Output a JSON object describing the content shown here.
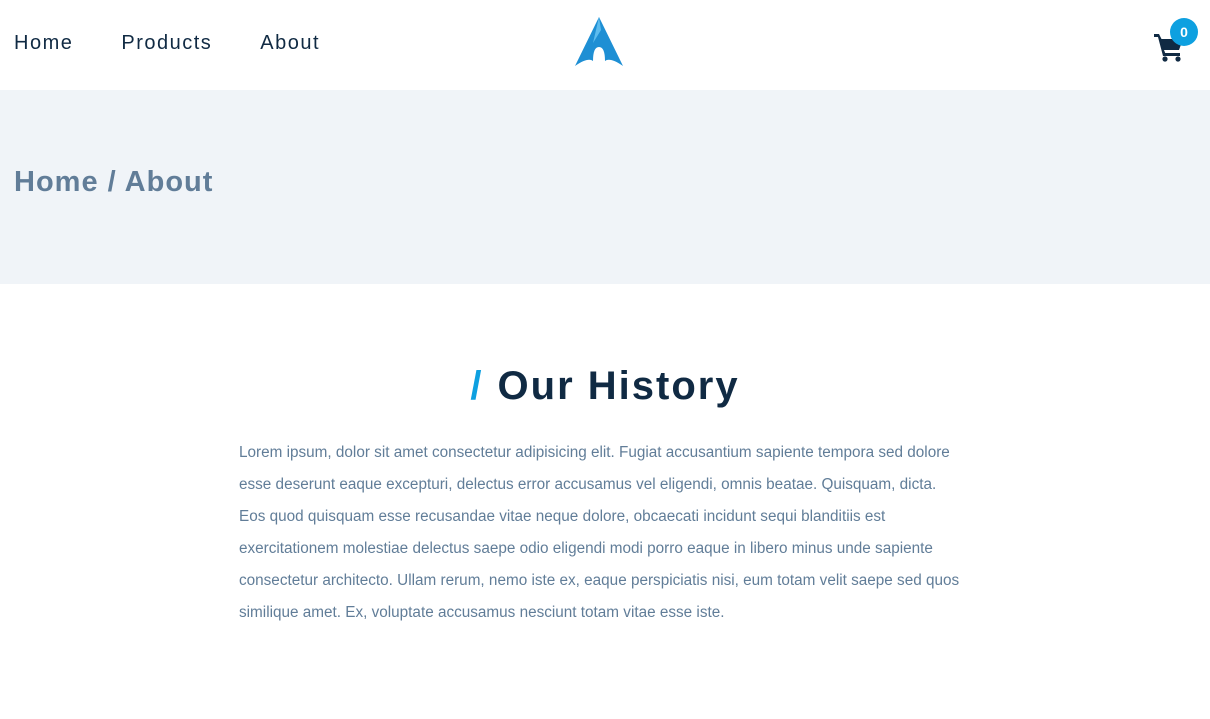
{
  "nav": {
    "links": [
      "Home",
      "Products",
      "About"
    ],
    "logo_icon": "logo-a-icon",
    "cart_icon": "cart-icon",
    "cart_count": "0"
  },
  "hero": {
    "breadcrumb": "Home / About"
  },
  "history": {
    "slash": "/",
    "title": "Our History",
    "text": "Lorem ipsum, dolor sit amet consectetur adipisicing elit. Fugiat accusantium sapiente tempora sed dolore esse deserunt eaque excepturi, delectus error accusamus vel eligendi, omnis beatae. Quisquam, dicta. Eos quod quisquam esse recusandae vitae neque dolore, obcaecati incidunt sequi blanditiis est exercitationem molestiae delectus saepe odio eligendi modi porro eaque in libero minus unde sapiente consectetur architecto. Ullam rerum, nemo iste ex, eaque perspiciatis nisi, eum totam velit saepe sed quos similique amet. Ex, voluptate accusamus nesciunt totam vitae esse iste."
  },
  "colors": {
    "primary": "#0ea0e0",
    "dark": "#102a43",
    "muted": "#617d98",
    "hero_bg": "#f0f4f8"
  }
}
